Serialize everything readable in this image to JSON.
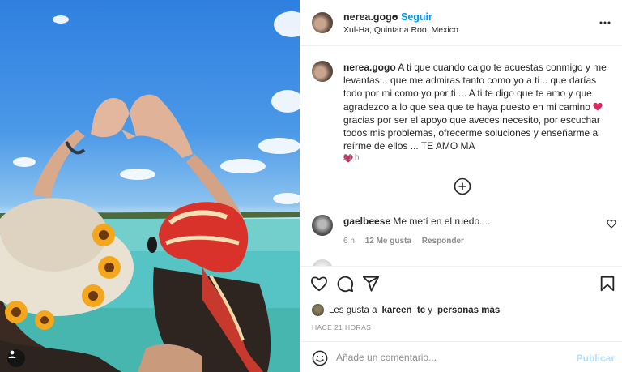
{
  "post": {
    "username": "nerea.gogo",
    "dot": "•",
    "follow_label": "Seguir",
    "location": "Xul-Ha, Quintana Roo, Mexico",
    "caption_part1": " A ti que cuando caigo te acuestas conmigo y me levantas .. que me admiras tanto como yo a ti .. que darías todo por mi como yo por ti ... A ti te digo que te amo y que agradezco a lo que sea que te haya puesto en mi camino ",
    "caption_part2": " gracias por ser el apoyo que aveces necesito, por escuchar todos mis problemas, ofrecerme soluciones y enseñarme a reírme de ellos ... TE AMO MA",
    "caption_time": "21 h"
  },
  "comment": {
    "username": "gaelbeese",
    "text": "Me metí en el ruedo....",
    "time": "6 h",
    "likes": "12 Me gusta",
    "reply_label": "Responder"
  },
  "likes": {
    "prefix": "Les gusta a",
    "user": "kareen_tc",
    "conjunction": "y",
    "others": "personas más"
  },
  "time_ago": "HACE 21 HORAS",
  "add_comment": {
    "placeholder": "Añade un comentario...",
    "publish_label": "Publicar"
  },
  "icons": {
    "more": "more-options-icon",
    "load_more": "plus-circle-icon",
    "like": "heart-outline-icon",
    "comment": "comment-bubble-icon",
    "share": "paper-plane-icon",
    "save": "bookmark-icon",
    "emoji": "emoji-smiley-icon",
    "user_tag": "user-tag-icon",
    "heart_emoji": "red-heart-emoji"
  },
  "colors": {
    "link_blue": "#0095f6",
    "publish_disabled": "#b2dffc",
    "heart_red": "#e0245e",
    "muted": "#8e8e8e"
  }
}
